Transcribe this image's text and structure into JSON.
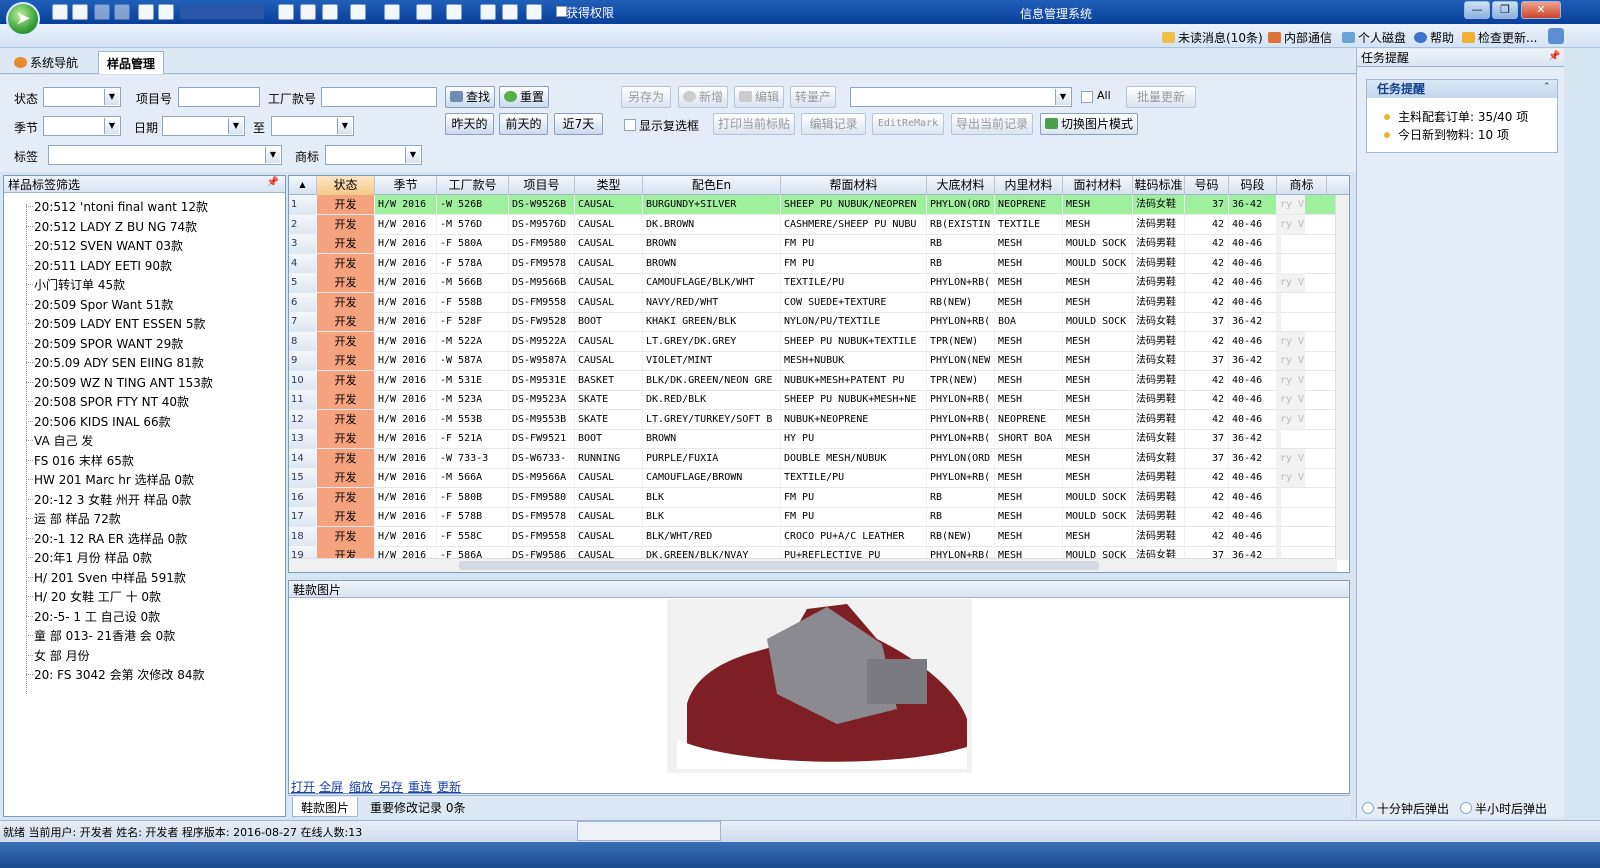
{
  "window": {
    "title": "信息管理系统",
    "permission_label": "获得权限",
    "buttons": {
      "minimize": "—",
      "maximize": "❐",
      "close": "✕"
    }
  },
  "topbar": {
    "unread": "未读消息(10条)",
    "internal": "内部通信",
    "disk": "个人磁盘",
    "help": "帮助",
    "update": "检查更新..."
  },
  "tabs": {
    "nav": "系统导航",
    "sample": "样品管理",
    "close": "✕"
  },
  "filters": {
    "status_label": "状态",
    "item_label": "项目号",
    "factory_label": "工厂款号",
    "search_btn": "查找",
    "reset_btn": "重置",
    "season_label": "季节",
    "date_label": "日期",
    "to_label": "至",
    "yesterday_btn": "昨天的",
    "before_btn": "前天的",
    "last7_btn": "近7天",
    "tag_label": "标签",
    "brand_label": "商标",
    "saveas_btn": "另存为",
    "add_btn": "新增",
    "edit_btn": "编辑",
    "transfer_btn": "转量产",
    "all_label": "All",
    "batch_btn": "批量更新",
    "show_checkbox_label": "显示复选框",
    "print_btn": "打印当前标贴",
    "edit_record_btn": "编辑记录",
    "edit_remark_btn": "EditReMark",
    "export_btn": "导出当前记录",
    "switch_btn": "切换图片模式"
  },
  "left_panel": {
    "title": "样品标签筛选",
    "items": [
      "20:512 'ntoni final want 12款",
      "20:512 LADY Z BU NG 74款",
      "20:512 SVEN WANT 03款",
      "20:511 LADY EETI 90款",
      "小门转订单 45款",
      "20:509 Spor Want 51款",
      "20:509 LADY ENT ESSEN 5款",
      "20:509 SPOR WANT 29款",
      "20:5.09 ADY SEN EIING 81款",
      "20:509 WZ N TING ANT 153款",
      "20:508 SPOR FTY NT 40款",
      "20:506 KIDS INAL 66款",
      "VA 自己 发 ",
      "FS 016 末样 65款",
      "HW 201 Marc hr 选样品 0款",
      "20:-12 3 女鞋 州开 样品 0款",
      "运 部 样品 72款",
      "20:-1 12 RA ER 选样品 0款",
      "20:年1 月份 样品 0款",
      "H/ 201 Sven 中样品 591款",
      "H/ 20 女鞋 工厂 十 0款",
      "20:-5- 1 工 自己设 0款",
      "童 部 013- 21香港 会 0款",
      "女 部 月份 ",
      "20: FS 3042 会第 次修改 84款"
    ]
  },
  "grid": {
    "sort_icon": "▲",
    "columns": [
      "状态",
      "季节",
      "工厂款号",
      "项目号",
      "类型",
      "配色En",
      "帮面材料",
      "大底材料",
      "内里材料",
      "面衬材料",
      "鞋码标准",
      "号码",
      "码段",
      "商标"
    ],
    "rows": [
      [
        "1",
        "开发",
        "H/W 2016",
        "-W 526B",
        "DS-W9526B",
        "CAUSAL",
        "BURGUNDY+SILVER",
        "SHEEP PU NUBUK/NEOPREN",
        "PHYLON(ORD",
        "NEOPRENE",
        "MESH",
        "法码女鞋",
        "37",
        "36-42",
        "ry V"
      ],
      [
        "2",
        "开发",
        "H/W 2016",
        "-M 576D",
        "DS-M9576D",
        "CAUSAL",
        "DK.BROWN",
        "CASHMERE/SHEEP PU NUBU",
        "RB(EXISTIN",
        "TEXTILE",
        "MESH",
        "法码男鞋",
        "42",
        "40-46",
        "ry V"
      ],
      [
        "3",
        "开发",
        "H/W 2016",
        "-F 580A",
        "DS-FM9580",
        "CAUSAL",
        "BROWN",
        "FM PU",
        "RB",
        "MESH",
        "MOULD SOCK",
        "法码男鞋",
        "42",
        "40-46",
        ""
      ],
      [
        "4",
        "开发",
        "H/W 2016",
        "-F 578A",
        "DS-FM9578",
        "CAUSAL",
        "BROWN",
        "FM PU",
        "RB",
        "MESH",
        "MOULD SOCK",
        "法码男鞋",
        "42",
        "40-46",
        ""
      ],
      [
        "5",
        "开发",
        "H/W 2016",
        "-M 566B",
        "DS-M9566B",
        "CAUSAL",
        "CAMOUFLAGE/BLK/WHT",
        "TEXTILE/PU",
        "PHYLON+RB(",
        "MESH",
        "MESH",
        "法码男鞋",
        "42",
        "40-46",
        "ry V"
      ],
      [
        "6",
        "开发",
        "H/W 2016",
        "-F 558B",
        "DS-FM9558",
        "CAUSAL",
        "NAVY/RED/WHT",
        "COW SUEDE+TEXTURE",
        "RB(NEW)",
        "MESH",
        "MESH",
        "法码男鞋",
        "42",
        "40-46",
        ""
      ],
      [
        "7",
        "开发",
        "H/W 2016",
        "-F 528F",
        "DS-FW9528",
        "BOOT",
        "KHAKI GREEN/BLK",
        "NYLON/PU/TEXTILE",
        "PHYLON+RB(",
        "BOA",
        "MOULD SOCK",
        "法码女鞋",
        "37",
        "36-42",
        ""
      ],
      [
        "8",
        "开发",
        "H/W 2016",
        "-M 522A",
        "DS-M9522A",
        "CAUSAL",
        "LT.GREY/DK.GREY",
        "SHEEP PU NUBUK+TEXTILE",
        "TPR(NEW)",
        "MESH",
        "MESH",
        "法码男鞋",
        "42",
        "40-46",
        "ry V"
      ],
      [
        "9",
        "开发",
        "H/W 2016",
        "-W 587A",
        "DS-W9587A",
        "CAUSAL",
        "VIOLET/MINT",
        "MESH+NUBUK",
        "PHYLON(NEW",
        "MESH",
        "MESH",
        "法码女鞋",
        "37",
        "36-42",
        "ry V"
      ],
      [
        "10",
        "开发",
        "H/W 2016",
        "-M 531E",
        "DS-M9531E",
        "BASKET",
        "BLK/DK.GREEN/NEON GRE",
        "NUBUK+MESH+PATENT PU",
        "TPR(NEW)",
        "MESH",
        "MESH",
        "法码男鞋",
        "42",
        "40-46",
        "ry V"
      ],
      [
        "11",
        "开发",
        "H/W 2016",
        "-M 523A",
        "DS-M9523A",
        "SKATE",
        "DK.RED/BLK",
        "SHEEP PU NUBUK+MESH+NE",
        "PHYLON+RB(",
        "MESH",
        "MESH",
        "法码男鞋",
        "42",
        "40-46",
        "ry V"
      ],
      [
        "12",
        "开发",
        "H/W 2016",
        "-M 553B",
        "DS-M9553B",
        "SKATE",
        "LT.GREY/TURKEY/SOFT B",
        "NUBUK+NEOPRENE",
        "PHYLON+RB(",
        "NEOPRENE",
        "MESH",
        "法码男鞋",
        "42",
        "40-46",
        "ry V"
      ],
      [
        "13",
        "开发",
        "H/W 2016",
        "-F 521A",
        "DS-FW9521",
        "BOOT",
        "BROWN",
        "HY PU",
        "PHYLON+RB(",
        "SHORT BOA",
        "MESH",
        "法码女鞋",
        "37",
        "36-42",
        ""
      ],
      [
        "14",
        "开发",
        "H/W 2016",
        "-W 733-3",
        "DS-W6733-",
        "RUNNING",
        "PURPLE/FUXIA",
        "DOUBLE MESH/NUBUK",
        "PHYLON(ORD",
        "MESH",
        "MESH",
        "法码女鞋",
        "37",
        "36-42",
        "ry V"
      ],
      [
        "15",
        "开发",
        "H/W 2016",
        "-M 566A",
        "DS-M9566A",
        "CAUSAL",
        "CAMOUFLAGE/BROWN",
        "TEXTILE/PU",
        "PHYLON+RB(",
        "MESH",
        "MESH",
        "法码男鞋",
        "42",
        "40-46",
        "ry V"
      ],
      [
        "16",
        "开发",
        "H/W 2016",
        "-F 580B",
        "DS-FM9580",
        "CAUSAL",
        "BLK",
        "FM PU",
        "RB",
        "MESH",
        "MOULD SOCK",
        "法码男鞋",
        "42",
        "40-46",
        ""
      ],
      [
        "17",
        "开发",
        "H/W 2016",
        "-F 578B",
        "DS-FM9578",
        "CAUSAL",
        "BLK",
        "FM PU",
        "RB",
        "MESH",
        "MOULD SOCK",
        "法码男鞋",
        "42",
        "40-46",
        ""
      ],
      [
        "18",
        "开发",
        "H/W 2016",
        "-F 558C",
        "DS-FM9558",
        "CAUSAL",
        "BLK/WHT/RED",
        "CROCO PU+A/C LEATHER",
        "RB(NEW)",
        "MESH",
        "MESH",
        "法码男鞋",
        "42",
        "40-46",
        ""
      ],
      [
        "19",
        "开发",
        "H/W 2016",
        "-F 586A",
        "DS-FW9586",
        "CAUSAL",
        "DK.GREEN/BLK/NVAY",
        "PU+REFLECTIVE PU",
        "PHYLON+RB(",
        "MESH",
        "MOULD SOCK",
        "法码女鞋",
        "37",
        "36-42",
        ""
      ]
    ]
  },
  "image_panel": {
    "title": "鞋款图片",
    "links": [
      "打开",
      "全屏",
      "缩放",
      "另存",
      "重连",
      "更新"
    ],
    "subtabs": [
      "鞋款图片",
      "重要修改记录 0条"
    ]
  },
  "right_panel": {
    "title": "任务提醒",
    "box_title": "任务提醒",
    "items": [
      "主料配套订单: 35/40 项",
      "今日新到物料: 10 项"
    ],
    "radio1": "十分钟后弹出",
    "radio2": "半小时后弹出"
  },
  "status_bar": {
    "text": "就绪 当前用户: 开发者 姓名: 开发者 程序版本: 2016-08-27 在线人数:13"
  },
  "colors": {
    "status_cell": "#f5a27e",
    "selected_row": "#9ff09d",
    "title_bar": "#1f5fb8"
  }
}
